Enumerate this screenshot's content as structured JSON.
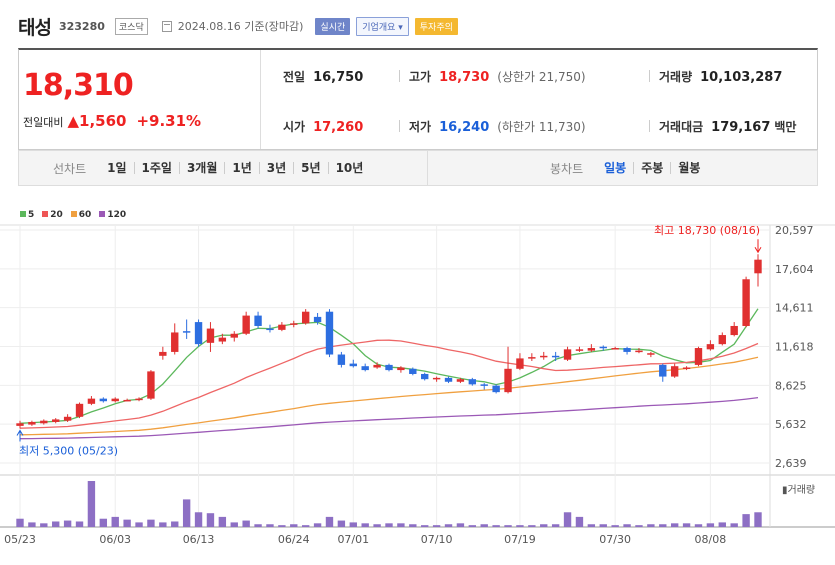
{
  "header": {
    "name": "태성",
    "code": "323280",
    "market": "코스닥",
    "date": "2024.08.16 기준(장마감)",
    "badge_realtime": "실시간",
    "badge_company": "기업개요 ▾",
    "badge_warning": "투자주의"
  },
  "price": {
    "current": "18,310",
    "change_label": "전일대비",
    "change_value": "▲1,560",
    "change_pct": "+9.31%",
    "prev_label": "전일",
    "prev_value": "16,750",
    "high_label": "고가",
    "high_value": "18,730",
    "upper_limit": "(상한가 21,750)",
    "volume_label": "거래량",
    "volume_value": "10,103,287",
    "open_label": "시가",
    "open_value": "17,260",
    "low_label": "저가",
    "low_value": "16,240",
    "lower_limit": "(하한가 11,730)",
    "amount_label": "거래대금",
    "amount_value": "179,167",
    "amount_unit": "백만"
  },
  "periods": {
    "line_label": "선차트",
    "line_items": [
      "1일",
      "1주일",
      "3개월",
      "1년",
      "3년",
      "5년",
      "10년"
    ],
    "candle_label": "봉차트",
    "candle_items": [
      "일봉",
      "주봉",
      "월봉"
    ],
    "candle_active": 0
  },
  "legend": [
    {
      "label": "5",
      "color": "#5cb85c"
    },
    {
      "label": "20",
      "color": "#e55"
    },
    {
      "label": "60",
      "color": "#f0a040"
    },
    {
      "label": "120",
      "color": "#9b59b6"
    }
  ],
  "chart_data": {
    "type": "candlestick",
    "y_ticks": [
      "20,597",
      "17,604",
      "14,611",
      "11,618",
      "8,625",
      "5,632",
      "2,639"
    ],
    "x_ticks": [
      "05/23",
      "06/03",
      "06/13",
      "06/24",
      "07/01",
      "07/10",
      "07/19",
      "07/30",
      "08/08"
    ],
    "high_annotation": "최고 18,730 (08/16)",
    "low_annotation": "최저 5,300 (05/23)",
    "volume_label": "거래량",
    "candles": [
      {
        "o": 5500,
        "c": 5700,
        "h": 5900,
        "l": 5300
      },
      {
        "o": 5600,
        "c": 5800,
        "h": 5900,
        "l": 5500
      },
      {
        "o": 5700,
        "c": 5900,
        "h": 6000,
        "l": 5600
      },
      {
        "o": 5800,
        "c": 6000,
        "h": 6100,
        "l": 5700
      },
      {
        "o": 5900,
        "c": 6200,
        "h": 6400,
        "l": 5800
      },
      {
        "o": 6200,
        "c": 7200,
        "h": 7300,
        "l": 6100
      },
      {
        "o": 7200,
        "c": 7600,
        "h": 7800,
        "l": 7100
      },
      {
        "o": 7600,
        "c": 7400,
        "h": 7700,
        "l": 7300
      },
      {
        "o": 7400,
        "c": 7600,
        "h": 7700,
        "l": 7300
      },
      {
        "o": 7500,
        "c": 7500,
        "h": 7600,
        "l": 7400
      },
      {
        "o": 7500,
        "c": 7600,
        "h": 7700,
        "l": 7400
      },
      {
        "o": 7600,
        "c": 9700,
        "h": 9800,
        "l": 7500
      },
      {
        "o": 10900,
        "c": 11200,
        "h": 11600,
        "l": 10600
      },
      {
        "o": 11200,
        "c": 12700,
        "h": 13400,
        "l": 11000
      },
      {
        "o": 12800,
        "c": 12700,
        "h": 13700,
        "l": 12200
      },
      {
        "o": 13500,
        "c": 11800,
        "h": 13700,
        "l": 11600
      },
      {
        "o": 11900,
        "c": 13000,
        "h": 13500,
        "l": 11200
      },
      {
        "o": 12000,
        "c": 12300,
        "h": 12600,
        "l": 11800
      },
      {
        "o": 12300,
        "c": 12600,
        "h": 12800,
        "l": 12000
      },
      {
        "o": 12600,
        "c": 14000,
        "h": 14300,
        "l": 12500
      },
      {
        "o": 14000,
        "c": 13200,
        "h": 14300,
        "l": 13000
      },
      {
        "o": 13000,
        "c": 12900,
        "h": 13300,
        "l": 12700
      },
      {
        "o": 12900,
        "c": 13300,
        "h": 13500,
        "l": 12800
      },
      {
        "o": 13300,
        "c": 13400,
        "h": 13600,
        "l": 13100
      },
      {
        "o": 13400,
        "c": 14300,
        "h": 14500,
        "l": 13300
      },
      {
        "o": 13900,
        "c": 13500,
        "h": 14200,
        "l": 13300
      },
      {
        "o": 14300,
        "c": 11000,
        "h": 14500,
        "l": 10800
      },
      {
        "o": 11000,
        "c": 10200,
        "h": 11200,
        "l": 10000
      },
      {
        "o": 10300,
        "c": 10100,
        "h": 10600,
        "l": 10000
      },
      {
        "o": 10100,
        "c": 9800,
        "h": 10300,
        "l": 9700
      },
      {
        "o": 10000,
        "c": 10200,
        "h": 10400,
        "l": 9900
      },
      {
        "o": 10200,
        "c": 9800,
        "h": 10300,
        "l": 9700
      },
      {
        "o": 9800,
        "c": 10000,
        "h": 10100,
        "l": 9600
      },
      {
        "o": 9900,
        "c": 9500,
        "h": 10000,
        "l": 9400
      },
      {
        "o": 9500,
        "c": 9100,
        "h": 9600,
        "l": 9000
      },
      {
        "o": 9100,
        "c": 9200,
        "h": 9300,
        "l": 8900
      },
      {
        "o": 9200,
        "c": 8900,
        "h": 9300,
        "l": 8800
      },
      {
        "o": 8900,
        "c": 9100,
        "h": 9200,
        "l": 8800
      },
      {
        "o": 9100,
        "c": 8700,
        "h": 9200,
        "l": 8600
      },
      {
        "o": 8700,
        "c": 8600,
        "h": 8800,
        "l": 8300
      },
      {
        "o": 8600,
        "c": 8100,
        "h": 8700,
        "l": 8000
      },
      {
        "o": 8100,
        "c": 9900,
        "h": 11600,
        "l": 8000
      },
      {
        "o": 9900,
        "c": 10700,
        "h": 11100,
        "l": 9800
      },
      {
        "o": 10700,
        "c": 10800,
        "h": 11100,
        "l": 10500
      },
      {
        "o": 10800,
        "c": 10900,
        "h": 11200,
        "l": 10600
      },
      {
        "o": 10900,
        "c": 10800,
        "h": 11200,
        "l": 10500
      },
      {
        "o": 10600,
        "c": 11400,
        "h": 11600,
        "l": 10500
      },
      {
        "o": 11300,
        "c": 11400,
        "h": 11600,
        "l": 11200
      },
      {
        "o": 11300,
        "c": 11500,
        "h": 11800,
        "l": 11200
      },
      {
        "o": 11600,
        "c": 11500,
        "h": 11700,
        "l": 11300
      },
      {
        "o": 11500,
        "c": 11500,
        "h": 11600,
        "l": 11400
      },
      {
        "o": 11500,
        "c": 11200,
        "h": 11600,
        "l": 11000
      },
      {
        "o": 11200,
        "c": 11300,
        "h": 11500,
        "l": 11100
      },
      {
        "o": 11000,
        "c": 11100,
        "h": 11200,
        "l": 10800
      },
      {
        "o": 10200,
        "c": 9300,
        "h": 10300,
        "l": 8900
      },
      {
        "o": 9300,
        "c": 10100,
        "h": 10300,
        "l": 9200
      },
      {
        "o": 10000,
        "c": 10000,
        "h": 10100,
        "l": 9800
      },
      {
        "o": 10200,
        "c": 11500,
        "h": 11600,
        "l": 10100
      },
      {
        "o": 11400,
        "c": 11800,
        "h": 12100,
        "l": 11300
      },
      {
        "o": 11800,
        "c": 12500,
        "h": 12700,
        "l": 11700
      },
      {
        "o": 12500,
        "c": 13200,
        "h": 13500,
        "l": 12400
      },
      {
        "o": 13200,
        "c": 16800,
        "h": 17000,
        "l": 13100
      },
      {
        "o": 17260,
        "c": 18310,
        "h": 18730,
        "l": 16240
      }
    ],
    "volumes": [
      0.18,
      0.1,
      0.08,
      0.12,
      0.14,
      0.12,
      1.0,
      0.18,
      0.22,
      0.16,
      0.1,
      0.16,
      0.1,
      0.12,
      0.6,
      0.32,
      0.3,
      0.22,
      0.1,
      0.14,
      0.06,
      0.06,
      0.04,
      0.06,
      0.04,
      0.08,
      0.22,
      0.14,
      0.1,
      0.08,
      0.06,
      0.08,
      0.08,
      0.06,
      0.04,
      0.04,
      0.06,
      0.08,
      0.04,
      0.06,
      0.04,
      0.04,
      0.04,
      0.04,
      0.06,
      0.06,
      0.32,
      0.22,
      0.06,
      0.06,
      0.04,
      0.06,
      0.04,
      0.06,
      0.06,
      0.08,
      0.08,
      0.06,
      0.08,
      0.1,
      0.08,
      0.28,
      0.32
    ]
  }
}
